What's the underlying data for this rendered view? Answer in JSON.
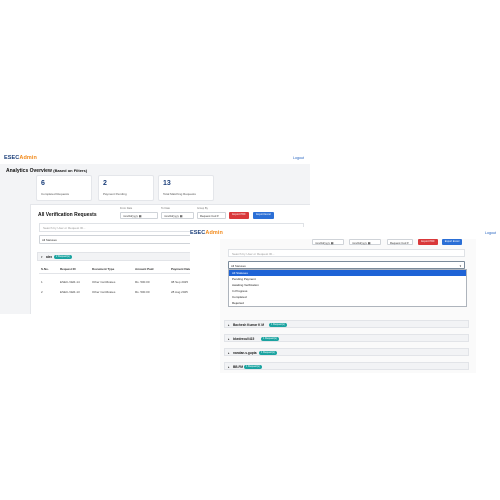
{
  "brand": {
    "part1": "ESEC",
    "part2": "Admin",
    "color_primary": "#1c3f7a",
    "color_accent": "#f28b1d"
  },
  "nav": {
    "logout": "Logout"
  },
  "analytics": {
    "title": "Analytics Overview",
    "subtitle": "(Based on Filters)",
    "cards": [
      {
        "value": "6",
        "label": "Completed Requests"
      },
      {
        "value": "2",
        "label": "Payment Pending"
      },
      {
        "value": "13",
        "label": "Total Matching Requests"
      }
    ]
  },
  "requests": {
    "title": "All Verification Requests",
    "from_label": "From Date",
    "to_label": "To Date",
    "group_by_label": "Group By",
    "date_placeholder": "mm/dd/yyyy",
    "group_by_value": "Request Cod",
    "export_pdf": "Export PDF",
    "export_excel": "Export Excel",
    "search_placeholder": "Search by User or Request ID...",
    "status_value": "All Statuses",
    "groups": [
      {
        "name": "alex",
        "badge": "2 Request(s)"
      },
      {
        "name": "Bachesh Kumar K M",
        "badge": "1 Request(s)"
      },
      {
        "name": "bkedrecu0415",
        "badge": "1 Request(s)"
      },
      {
        "name": "nandan.s.gupta",
        "badge": "1 Request(s)"
      },
      {
        "name": "BB.FM",
        "badge": "1 Request(s)"
      }
    ],
    "table": {
      "headers": [
        "S.No.",
        "Request ID",
        "Document Type",
        "Amount Paid",
        "Payment Date"
      ],
      "rows": [
        [
          "1",
          "ESEC-VER-14",
          "Other Certificates",
          "Rs. 500.00",
          "08 Sep 2025"
        ],
        [
          "2",
          "ESEC-VER-13",
          "Other Certificates",
          "Rs. 500.00",
          "28 Aug 2025"
        ]
      ]
    }
  },
  "status_dropdown": {
    "options": [
      "All Statuses",
      "Pending Payment",
      "Awaiting Verification",
      "In Progress",
      "Completed",
      "Rejected"
    ],
    "selected_index": 0
  }
}
